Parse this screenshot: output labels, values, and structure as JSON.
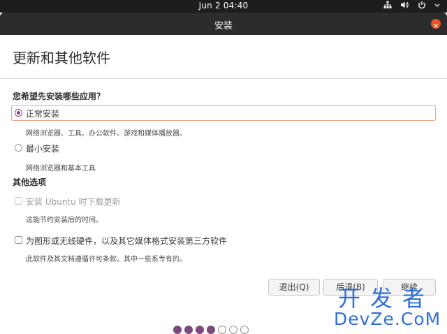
{
  "system_bar": {
    "clock": "Jun 2  04:40"
  },
  "window": {
    "title": "安装"
  },
  "page": {
    "heading": "更新和其他软件",
    "question": "您希望先安装哪些应用？"
  },
  "install_options": [
    {
      "label": "正常安装",
      "description": "网络浏览器、工具、办公软件、游戏和媒体播放器。",
      "selected": true
    },
    {
      "label": "最小安装",
      "description": "网络浏览器和基本工具",
      "selected": false
    }
  ],
  "other_options": {
    "heading": "其他选项",
    "items": [
      {
        "label": "安装 Ubuntu 时下载更新",
        "description": "这能节约安装后的时间。",
        "checked": false,
        "enabled": false
      },
      {
        "label": "为图形或无线硬件，以及其它媒体格式安装第三方软件",
        "description": "此软件及其文档遵循许可条款。其中一些系专有的。",
        "checked": false,
        "enabled": true
      }
    ]
  },
  "buttons": {
    "quit": "退出(Q)",
    "back": "后退(B)",
    "continue": "继续"
  },
  "progress": {
    "total_steps": 7,
    "completed_steps": 4
  },
  "watermark": {
    "line1": "开发者",
    "line2": "DevZe.CoM"
  },
  "colors": {
    "accent": "#e95420",
    "selection": "#8a3e8e",
    "progress": "#7b4a7f"
  }
}
